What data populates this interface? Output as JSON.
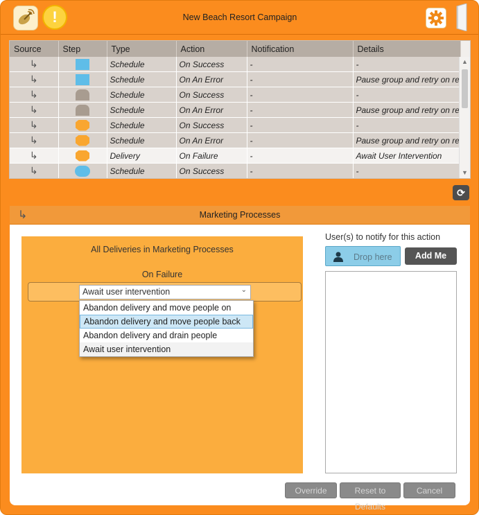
{
  "window": {
    "title": "New Beach Resort Campaign",
    "accent": "#fb8c1e"
  },
  "icons": {
    "app": "satellite-dish-icon",
    "alert": "exclamation-icon",
    "alert_glyph": "!",
    "settings": "gear-icon",
    "exit": "door-icon",
    "refresh": "refresh-icon",
    "refresh_glyph": "⟳",
    "row_arrow": "↳",
    "panel_arrow": "↳",
    "caret": "⌄",
    "person": "👤"
  },
  "table": {
    "columns": [
      "Source",
      "Step",
      "Type",
      "Action",
      "Notification",
      "Details"
    ],
    "rows": [
      {
        "step_shape": "rect",
        "step_color": "#5fbde8",
        "type": "Schedule",
        "action": "On Success",
        "notification": "-",
        "details": "-"
      },
      {
        "step_shape": "rect",
        "step_color": "#5fbde8",
        "type": "Schedule",
        "action": "On An Error",
        "notification": "-",
        "details": "Pause group and retry on res"
      },
      {
        "step_shape": "tomb",
        "step_color": "#a89c90",
        "type": "Schedule",
        "action": "On Success",
        "notification": "-",
        "details": "-"
      },
      {
        "step_shape": "tomb",
        "step_color": "#a89c90",
        "type": "Schedule",
        "action": "On An Error",
        "notification": "-",
        "details": "Pause group and retry on res"
      },
      {
        "step_shape": "oct",
        "step_color": "#f9a630",
        "type": "Schedule",
        "action": "On Success",
        "notification": "-",
        "details": "-"
      },
      {
        "step_shape": "oct",
        "step_color": "#f9a630",
        "type": "Schedule",
        "action": "On An Error",
        "notification": "-",
        "details": "Pause group and retry on res"
      },
      {
        "step_shape": "oct",
        "step_color": "#f9a630",
        "type": "Delivery",
        "action": "On Failure",
        "notification": "-",
        "details": "Await User Intervention",
        "selected": true
      },
      {
        "step_shape": "pill",
        "step_color": "#5fbde8",
        "type": "Schedule",
        "action": "On Success",
        "notification": "-",
        "details": "-"
      }
    ]
  },
  "panel": {
    "title": "Marketing Processes",
    "card_title": "All Deliveries in Marketing Processes",
    "on_label": "On Failure",
    "dropdown": {
      "selected": "Await user intervention",
      "options": [
        "Abandon delivery and move people on",
        "Abandon delivery and move people back",
        "Abandon delivery and drain people",
        "Await user intervention"
      ],
      "highlighted_index": 1
    },
    "notify": {
      "label": "User(s) to notify for this action",
      "drop_placeholder": "Drop here",
      "add_me": "Add Me"
    }
  },
  "footer": {
    "override": "Override",
    "reset": "Reset to Defaults",
    "cancel": "Cancel"
  }
}
